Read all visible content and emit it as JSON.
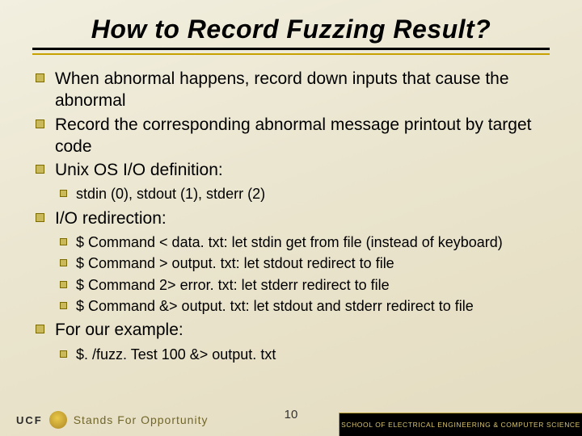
{
  "title": "How to Record Fuzzing Result?",
  "bullets": {
    "b1": "When abnormal happens, record down inputs that cause the abnormal",
    "b2": "Record the corresponding abnormal message printout by target code",
    "b3": "Unix OS I/O definition:",
    "b3_sub": {
      "s1": "stdin (0), stdout (1), stderr (2)"
    },
    "b4": "I/O redirection:",
    "b4_sub": {
      "s1": "$ Command < data. txt:  let stdin get from file (instead of keyboard)",
      "s2": "$ Command > output. txt:  let stdout redirect to file",
      "s3": "$ Command 2> error. txt:  let stderr redirect to file",
      "s4": "$ Command &> output. txt:  let stdout and stderr redirect to file"
    },
    "b5": "For our example:",
    "b5_sub": {
      "s1": "$. /fuzz. Test 100 &> output. txt"
    }
  },
  "footer": {
    "page": "10",
    "ucf": "UCF",
    "motto": "Stands For Opportunity",
    "dept": "SCHOOL OF ELECTRICAL ENGINEERING & COMPUTER SCIENCE"
  }
}
